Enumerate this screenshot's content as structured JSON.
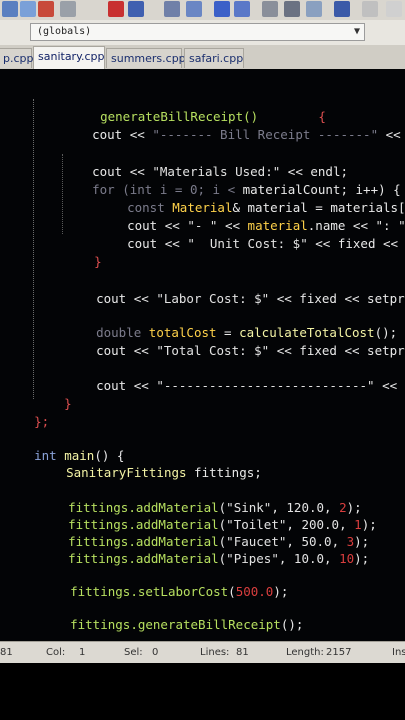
{
  "scope_combo": {
    "value": "(globals)"
  },
  "tabs": [
    {
      "label": "p.cpp"
    },
    {
      "label": "sanitary.cpp"
    },
    {
      "label": "summers.cpp"
    },
    {
      "label": "safari.cpp"
    }
  ],
  "code": {
    "l1": {
      "a": "generateBillReceipt()",
      "b": "{"
    },
    "l2": {
      "a": "cout << ",
      "b": "\"------- Bill Receipt -------\"",
      "c": " <<"
    },
    "l3": {
      "a": "cout << ",
      "b": "\"Materials Used:\"",
      "c": " << endl;"
    },
    "l4": {
      "a": "for (int i = 0; i < ",
      "b": "materialCount",
      "c": "; i++) {"
    },
    "l5": {
      "a": "const ",
      "b": "Material",
      "c": "& material = materials["
    },
    "l6": {
      "a": "cout << ",
      "b": "\"- \"",
      "c": " << ",
      "d": "material",
      "e": ".name << ",
      "f": "\": \""
    },
    "l7": {
      "a": "cout << ",
      "b": "\"  Unit Cost: $\"",
      "c": " << fixed <<"
    },
    "l8": {
      "a": "}"
    },
    "l9": {
      "a": "cout << ",
      "b": "\"Labor Cost: $\"",
      "c": " << fixed << setpr"
    },
    "l10": {
      "a": "double ",
      "b": "totalCost",
      "c": " = ",
      "d": "calculateTotalCost",
      "e": "();"
    },
    "l11": {
      "a": "cout << ",
      "b": "\"Total Cost: $\"",
      "c": " << fixed << setpr"
    },
    "l12": {
      "a": "cout << ",
      "b": "\"---------------------------\"",
      "c": " <<"
    },
    "l13": {
      "a": "}"
    },
    "l14": {
      "a": "};"
    },
    "l15": {
      "a": "int ",
      "b": "main",
      "c": "() {"
    },
    "l16": {
      "a": "SanitaryFittings ",
      "b": "fittings;"
    },
    "l17": {
      "a": "fittings.",
      "b": "addMaterial",
      "c": "(",
      "d": "\"Sink\"",
      "e": ", ",
      "f": "120.0",
      "g": ", ",
      "h": "2",
      "i": ");"
    },
    "l18": {
      "a": "fittings.",
      "b": "addMaterial",
      "c": "(",
      "d": "\"Toilet\"",
      "e": ", ",
      "f": "200.0",
      "g": ", ",
      "h": "1",
      "i": ");"
    },
    "l19": {
      "a": "fittings.",
      "b": "addMaterial",
      "c": "(",
      "d": "\"Faucet\"",
      "e": ", ",
      "f": "50.0",
      "g": ", ",
      "h": "3",
      "i": ");"
    },
    "l20": {
      "a": "fittings.",
      "b": "addMaterial",
      "c": "(",
      "d": "\"Pipes\"",
      "e": ", ",
      "f": "10.0",
      "g": ", ",
      "h": "10",
      "i": ");"
    },
    "l21": {
      "a": "fittings.",
      "b": "setLaborCost",
      "c": "(",
      "d": "500.0",
      "e": ");"
    },
    "l22": {
      "a": "fittings.",
      "b": "generateBillReceipt",
      "c": "();"
    }
  },
  "status": {
    "line_num": "81",
    "col_label": "Col:",
    "col_val": "1",
    "sel_label": "Sel:",
    "sel_val": "0",
    "lines_label": "Lines:",
    "lines_val": "81",
    "length_label": "Length:",
    "length_val": "2157",
    "ins": "Ins"
  },
  "colors": {
    "editor_bg": "#030406",
    "keyword": "#8aa2d8",
    "function": "#c8d93a",
    "string": "#e2e2e2",
    "number": "#d93e3e"
  }
}
